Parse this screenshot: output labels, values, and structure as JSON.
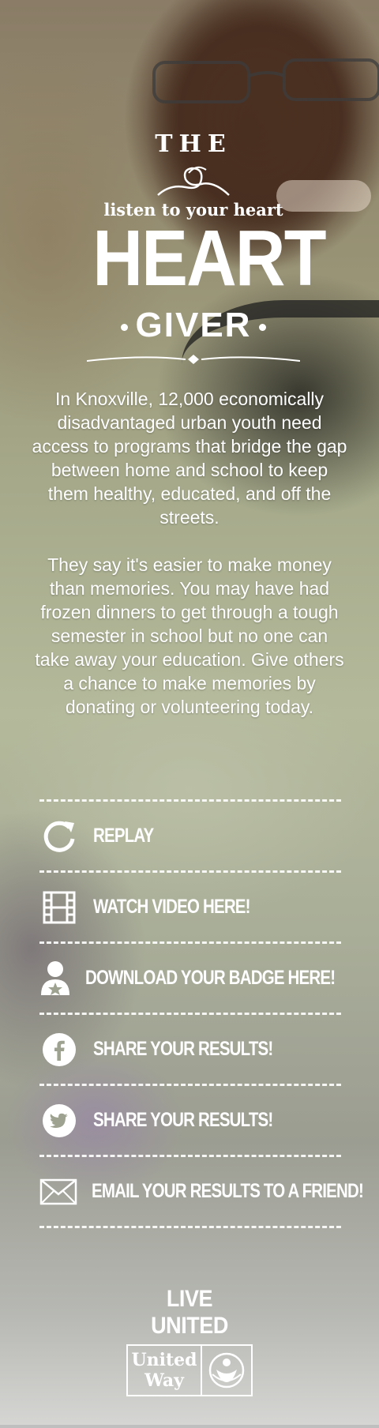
{
  "logo": {
    "the": "THE",
    "tagline": "listen to your heart",
    "heart": "HEART",
    "giver": "GIVER"
  },
  "copy": {
    "paragraph1": "In Knoxville, 12,000 economically disadvantaged urban youth need access to programs that bridge the gap between home and school to keep them healthy, educated, and off the streets.",
    "paragraph2": "They say it's easier to make money than memories. You may have had frozen dinners to get through a tough semester in school but no one can take away your education.  Give others a chance to make memories by donating or volunteering today."
  },
  "menu": {
    "items": [
      {
        "label": "REPLAY",
        "icon": "replay-icon"
      },
      {
        "label": "WATCH VIDEO HERE!",
        "icon": "film-icon"
      },
      {
        "label": "DOWNLOAD YOUR BADGE HERE!",
        "icon": "badge-user-icon"
      },
      {
        "label": "SHARE YOUR RESULTS!",
        "icon": "facebook-icon"
      },
      {
        "label": "SHARE YOUR RESULTS!",
        "icon": "twitter-icon"
      },
      {
        "label": "EMAIL YOUR RESULTS TO A FRIEND!",
        "icon": "envelope-icon"
      }
    ]
  },
  "footer": {
    "live_united": "LIVE UNITED",
    "united": "United",
    "way": "Way"
  },
  "colors": {
    "text": "#ffffff",
    "background_top": "#8a7c66",
    "background_mid": "#b4b99b",
    "background_bottom": "#d6d6d4"
  }
}
